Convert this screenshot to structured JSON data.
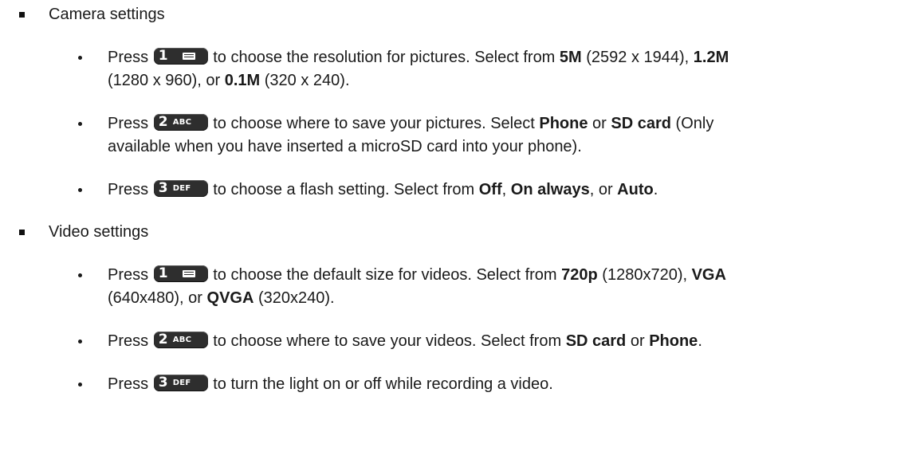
{
  "sections": [
    {
      "label": "Camera settings",
      "items": [
        {
          "key": {
            "num": "1",
            "sub": "",
            "icon": "envelope-icon"
          },
          "lines": [
            [
              "Press ",
              "{key}",
              " to choose the resolution for pictures. Select from ",
              "**5M**",
              " (2592 x 1944), ",
              "**1.2M**"
            ],
            [
              "(1280 x 960), or ",
              "**0.1M**",
              " (320 x 240)."
            ]
          ]
        },
        {
          "key": {
            "num": "2",
            "sub": "ABC",
            "icon": ""
          },
          "lines": [
            [
              "Press ",
              "{key}",
              " to choose where to save your pictures. Select ",
              "**Phone**",
              " or ",
              "**SD card**",
              " (Only"
            ],
            [
              "available when you have inserted a microSD card into your phone)."
            ]
          ]
        },
        {
          "key": {
            "num": "3",
            "sub": "DEF",
            "icon": ""
          },
          "lines": [
            [
              "Press ",
              "{key}",
              " to choose a flash setting. Select from ",
              "**Off**",
              ", ",
              "**On always**",
              ", or ",
              "**Auto**",
              "."
            ]
          ]
        }
      ]
    },
    {
      "label": "Video settings",
      "items": [
        {
          "key": {
            "num": "1",
            "sub": "",
            "icon": "envelope-icon"
          },
          "lines": [
            [
              "Press ",
              "{key}",
              " to choose the default size for videos. Select from ",
              "**720p**",
              " (1280x720), ",
              "**VGA**"
            ],
            [
              "(640x480), or ",
              "**QVGA**",
              " (320x240)."
            ]
          ]
        },
        {
          "key": {
            "num": "2",
            "sub": "ABC",
            "icon": ""
          },
          "lines": [
            [
              "Press ",
              "{key}",
              " to choose where to save your videos. Select from ",
              "**SD card**",
              " or ",
              "**Phone**",
              "."
            ]
          ]
        },
        {
          "key": {
            "num": "3",
            "sub": "DEF",
            "icon": ""
          },
          "lines": [
            [
              "Press ",
              "{key}",
              " to turn the light on or off while recording a video."
            ]
          ]
        }
      ]
    }
  ]
}
